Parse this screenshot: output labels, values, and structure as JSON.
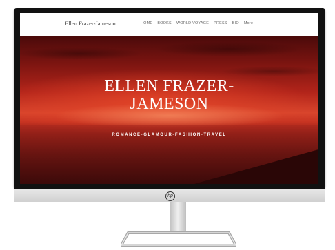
{
  "site": {
    "brand": "Ellen Frazer-Jameson",
    "nav": [
      "HOME",
      "BOOKS",
      "WORLD VOYAGE",
      "PRESS",
      "BIO",
      "More"
    ]
  },
  "hero": {
    "title": "ELLEN FRAZER-\nJAMESON",
    "subtitle": "ROMANCE-GLAMOUR-FASHION-TRAVEL"
  },
  "device": {
    "logo": "hp"
  },
  "colors": {
    "sunset_red": "#b2241a",
    "bezel": "#111111"
  }
}
